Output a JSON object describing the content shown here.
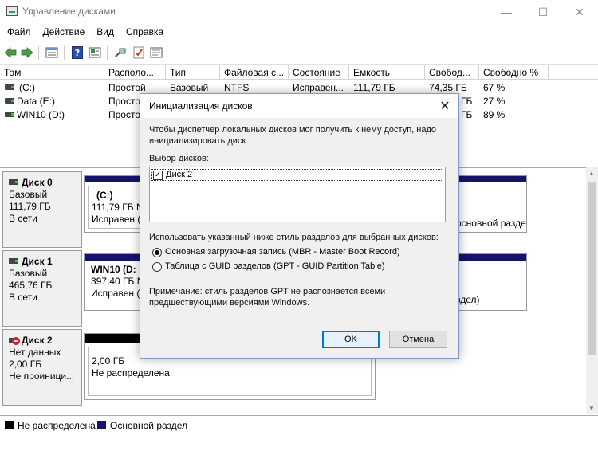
{
  "window": {
    "title": "Управление дисками",
    "minimize": "—",
    "maximize": "☐",
    "close": "✕"
  },
  "menu": [
    "Файл",
    "Действие",
    "Вид",
    "Справка"
  ],
  "toolbar": {
    "icons": [
      "back-arrow-icon",
      "forward-arrow-icon",
      "list-view-icon",
      "help-icon",
      "properties-icon",
      "connect-icon",
      "check-icon",
      "settings-icon"
    ]
  },
  "volumes": {
    "columns": [
      "Том",
      "Располо...",
      "Тип",
      "Файловая с...",
      "Состояние",
      "Емкость",
      "Свобод...",
      "Свободно %"
    ],
    "rows": [
      {
        "name": "(C:)",
        "layout": "Простой",
        "type": "Базовый",
        "fs": "NTFS",
        "state": "Исправен...",
        "capacity": "111,79 ГБ",
        "free": "74,35 ГБ",
        "free_pct": "67 %"
      },
      {
        "name": "Data (E:)",
        "layout": "Простой",
        "type": "",
        "fs": "",
        "state": "",
        "capacity": "",
        "free": "ГБ",
        "free_pct": "27 %"
      },
      {
        "name": "WIN10 (D:)",
        "layout": "Простой",
        "type": "",
        "fs": "",
        "state": "",
        "capacity": "",
        "free": "ГБ",
        "free_pct": "89 %"
      }
    ]
  },
  "disks": [
    {
      "name": "Диск 0",
      "type": "Базовый",
      "size": "111,79 ГБ",
      "status": "В сети",
      "partition_title": "(C:)",
      "partition_size": "111,79 ГБ NT",
      "partition_state": "Исправен (",
      "right_text": "основной разде"
    },
    {
      "name": "Диск 1",
      "type": "Базовый",
      "size": "465,76 ГБ",
      "status": "В сети",
      "partition_title": "WIN10 (D:",
      "partition_size": "397,40 ГБ N",
      "partition_state": "Исправен (",
      "right_text": "здел)"
    },
    {
      "name": "Диск 2",
      "type": "Нет данных",
      "size": "2,00 ГБ",
      "status": "Не проиници...",
      "partition_size": "2,00 ГБ",
      "partition_state": "Не распределена"
    }
  ],
  "legend": {
    "unallocated": "Не распределена",
    "primary": "Основной раздел",
    "color_unallocated": "#000000",
    "color_primary": "#14146b"
  },
  "dialog": {
    "title": "Инициализация дисков",
    "intro": "Чтобы диспетчер локальных дисков мог получить к нему доступ, надо инициализировать диск.",
    "select_label": "Выбор дисков:",
    "disk_item": "Диск 2",
    "style_label": "Использовать указанный ниже стиль разделов для выбранных дисков:",
    "mbr": "Основная загрузочная запись (MBR - Master Boot Record)",
    "gpt": "Таблица с GUID разделов (GPT - GUID Partition Table)",
    "note": "Примечание: стиль разделов GPT не распознается всеми предшествующими версиями Windows.",
    "ok": "OK",
    "cancel": "Отмена"
  }
}
